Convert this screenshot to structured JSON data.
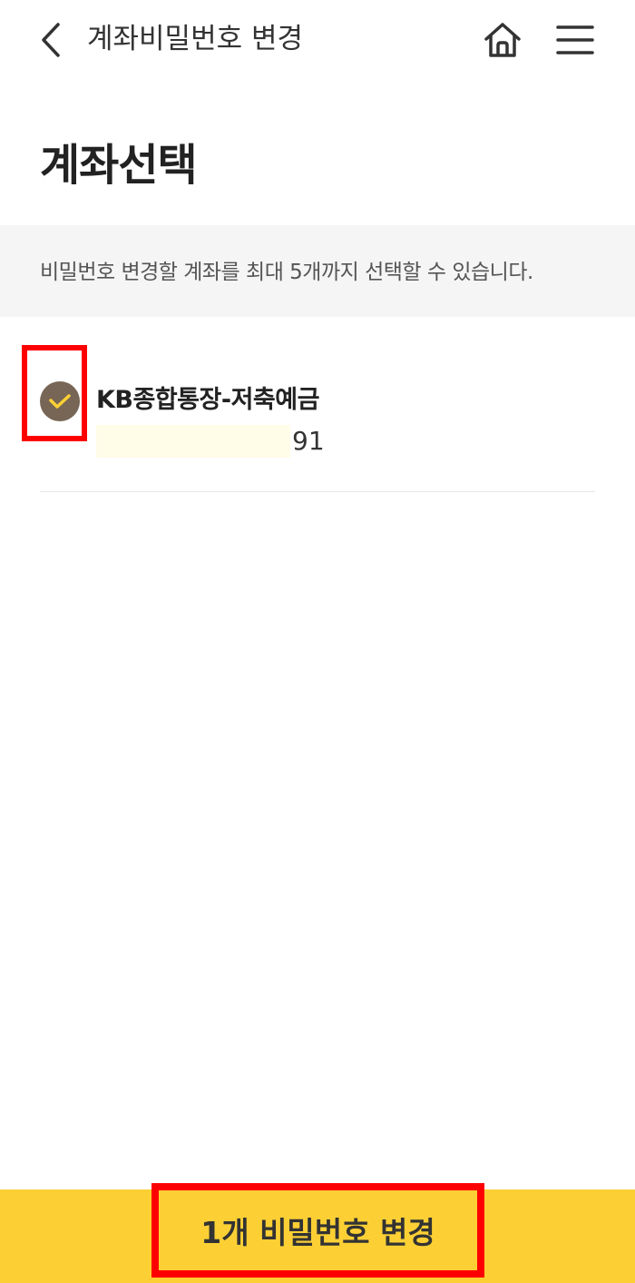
{
  "header": {
    "title": "계좌비밀번호 변경",
    "back_icon": "chevron-left-icon",
    "home_icon": "home-icon",
    "menu_icon": "hamburger-menu-icon"
  },
  "page": {
    "title": "계좌선택"
  },
  "notice": {
    "text": "비밀번호 변경할 계좌를 최대 5개까지 선택할 수 있습니다."
  },
  "accounts": [
    {
      "name": "KB종합통장-저축예금",
      "number_suffix": "91",
      "selected": true
    }
  ],
  "cta": {
    "label": "1개 비밀번호 변경"
  },
  "colors": {
    "accent_yellow": "#fcd034",
    "check_bg": "#776655",
    "check_mark": "#fcd034",
    "highlight_red": "#ff0000",
    "notice_bg": "#f5f5f5"
  }
}
